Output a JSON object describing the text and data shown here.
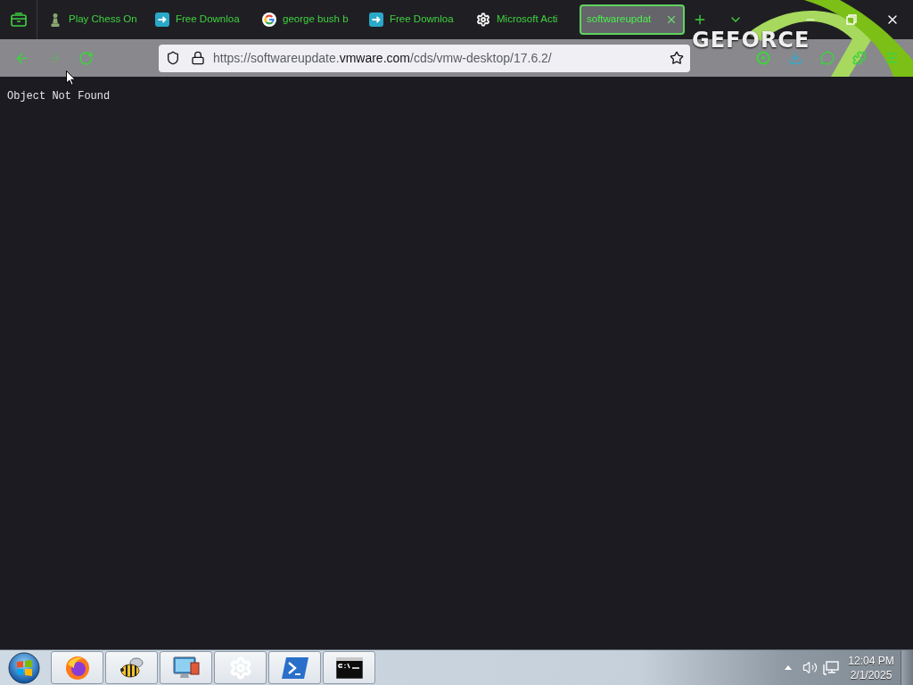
{
  "tab_bar": {
    "tabs": [
      {
        "title": "Play Chess On",
        "selected": false
      },
      {
        "title": "Free Downloa",
        "selected": false
      },
      {
        "title": "george bush b",
        "selected": false
      },
      {
        "title": "Free Downloa",
        "selected": false
      },
      {
        "title": "Microsoft Acti",
        "selected": false
      },
      {
        "title": "softwareupdat",
        "selected": true
      }
    ]
  },
  "theme_logo": {
    "text": "GEFORCE"
  },
  "toolbar": {
    "nav_buttons": [
      {
        "kind": "back",
        "disabled": false
      },
      {
        "kind": "forward",
        "disabled": true
      },
      {
        "kind": "reload",
        "disabled": false
      }
    ],
    "address_bar": {
      "url": [
        {
          "text": "https://softwareupdate.",
          "kind": "muted"
        },
        {
          "text": "vmware.com",
          "kind": "host"
        },
        {
          "text": "/cds/vmw-desktop/17.6.2/",
          "kind": "muted"
        }
      ]
    }
  },
  "page": {
    "text": "Object Not Found"
  },
  "taskbar": {
    "clock": {
      "time": "12:04 PM",
      "date": "2/1/2025"
    }
  }
}
